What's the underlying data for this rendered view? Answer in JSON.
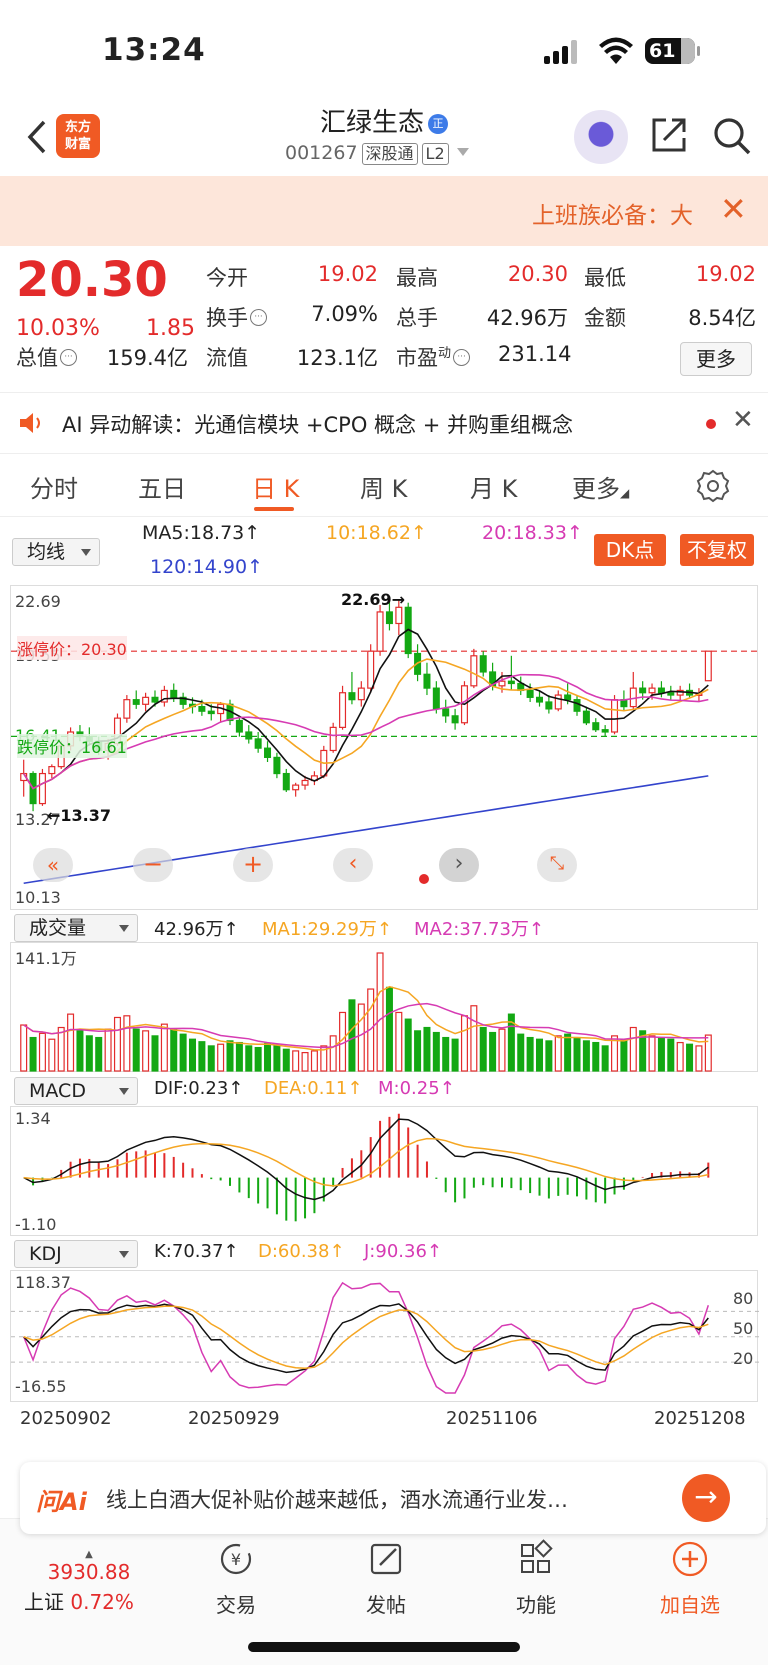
{
  "status": {
    "time": "13:24",
    "battery": "61"
  },
  "header": {
    "logo_line1": "东方",
    "logo_line2": "财富",
    "stock_name": "汇绿生态",
    "badge": "正",
    "code": "001267",
    "tag1": "深股通",
    "tag2": "L2"
  },
  "banner": {
    "text": "上班族必备：大"
  },
  "quote": {
    "price": "20.30",
    "pct": "10.03%",
    "change": "1.85",
    "r1": [
      {
        "label": "今开",
        "value": "19.02",
        "red": true
      },
      {
        "label": "最高",
        "value": "20.30",
        "red": true
      },
      {
        "label": "最低",
        "value": "19.02",
        "red": true
      }
    ],
    "r2": [
      {
        "label": "换手",
        "value": "7.09%"
      },
      {
        "label": "总手",
        "value": "42.96万"
      },
      {
        "label": "金额",
        "value": "8.54亿"
      }
    ],
    "r3": [
      {
        "label": "总值",
        "value": "159.4亿"
      },
      {
        "label": "流值",
        "value": "123.1亿"
      },
      {
        "label": "市盈",
        "sup": "动",
        "value": "231.14"
      }
    ],
    "more": "更多"
  },
  "ai": {
    "text": "AI 异动解读：光通信模块 +CPO 概念 + 并购重组概念"
  },
  "tabs": [
    "分时",
    "五日",
    "日 K",
    "周 K",
    "月 K",
    "更多"
  ],
  "active_tab": 2,
  "ma": {
    "select": "均线",
    "ma5": "MA5:18.73",
    "ma10": "10:18.62",
    "ma20": "20:18.33",
    "ma120": "120:14.90",
    "dk_btn": "DK点",
    "fq_btn": "不复权"
  },
  "kaxis": {
    "top": "22.69",
    "upper": "19.55",
    "mid": "16.41",
    "lower": "13.27",
    "bottom": "10.13",
    "high_label": "22.69",
    "low_label": "13.37",
    "limit_up": "涨停价：20.30",
    "limit_down": "跌停价：16.61"
  },
  "volume": {
    "select": "成交量",
    "val": "42.96万",
    "ma1": "MA1:29.29万",
    "ma2": "MA2:37.73万",
    "max": "141.1万"
  },
  "macd": {
    "select": "MACD",
    "dif": "DIF:0.23",
    "dea": "DEA:0.11",
    "m": "M:0.25",
    "top": "1.34",
    "bottom": "-1.10"
  },
  "kdj": {
    "select": "KDJ",
    "k": "K:70.37",
    "d": "D:60.38",
    "j": "J:90.36",
    "top": "118.37",
    "bottom": "-16.55",
    "l80": "80",
    "l50": "50",
    "l20": "20"
  },
  "dates": [
    "20250902",
    "20250929",
    "20251106",
    "20251208"
  ],
  "ask": {
    "logo": "问Ai",
    "text": "线上白酒大促补贴价越来越低，酒水流通行业发…"
  },
  "bottom": {
    "index_val": "3930.88",
    "index_name": "上证",
    "index_pct": "0.72%",
    "items": [
      "交易",
      "发帖",
      "功能",
      "加自选"
    ]
  },
  "colors": {
    "up": "#e32b2b",
    "down": "#13a813",
    "accent": "#f05a24",
    "ma10": "#f5a623",
    "ma20": "#d63bb3",
    "ma120": "#3344cc"
  },
  "chart_data": {
    "type": "candlestick",
    "ohlc": [
      [
        14.7,
        15.6,
        14.0,
        15.0
      ],
      [
        15.0,
        15.1,
        13.37,
        13.7
      ],
      [
        13.7,
        15.2,
        13.6,
        15.0
      ],
      [
        15.0,
        15.4,
        14.8,
        15.3
      ],
      [
        15.3,
        16.4,
        15.2,
        16.2
      ],
      [
        16.2,
        17.0,
        16.0,
        16.8
      ],
      [
        16.8,
        17.1,
        16.4,
        16.6
      ],
      [
        16.6,
        17.0,
        16.2,
        16.4
      ],
      [
        16.4,
        16.6,
        15.8,
        16.0
      ],
      [
        16.0,
        16.5,
        15.6,
        16.3
      ],
      [
        16.3,
        17.6,
        16.2,
        17.4
      ],
      [
        17.4,
        18.4,
        17.2,
        18.2
      ],
      [
        18.2,
        18.6,
        17.8,
        18.0
      ],
      [
        18.0,
        18.5,
        17.7,
        18.3
      ],
      [
        18.3,
        18.6,
        17.9,
        18.1
      ],
      [
        18.1,
        18.8,
        17.9,
        18.6
      ],
      [
        18.6,
        18.9,
        18.1,
        18.3
      ],
      [
        18.3,
        18.5,
        17.8,
        18.0
      ],
      [
        18.0,
        18.3,
        17.6,
        17.9
      ],
      [
        17.9,
        18.2,
        17.5,
        17.7
      ],
      [
        17.7,
        18.0,
        17.3,
        17.6
      ],
      [
        17.6,
        18.1,
        17.2,
        18.0
      ],
      [
        18.0,
        18.2,
        17.1,
        17.3
      ],
      [
        17.3,
        17.5,
        16.6,
        16.8
      ],
      [
        16.8,
        17.1,
        16.3,
        16.5
      ],
      [
        16.5,
        16.8,
        15.9,
        16.1
      ],
      [
        16.1,
        16.4,
        15.5,
        15.7
      ],
      [
        15.7,
        15.9,
        14.8,
        15.0
      ],
      [
        15.0,
        15.2,
        14.2,
        14.3
      ],
      [
        14.3,
        14.6,
        14.0,
        14.5
      ],
      [
        14.5,
        14.9,
        14.3,
        14.7
      ],
      [
        14.7,
        15.1,
        14.5,
        14.9
      ],
      [
        14.9,
        16.2,
        14.8,
        16.0
      ],
      [
        16.0,
        17.2,
        15.9,
        17.0
      ],
      [
        17.0,
        18.8,
        16.9,
        18.5
      ],
      [
        18.5,
        19.4,
        18.0,
        18.2
      ],
      [
        18.2,
        19.0,
        17.9,
        18.7
      ],
      [
        18.7,
        20.6,
        18.5,
        20.3
      ],
      [
        20.3,
        22.3,
        20.1,
        22.0
      ],
      [
        22.0,
        22.69,
        21.2,
        21.5
      ],
      [
        21.5,
        22.5,
        21.0,
        22.2
      ],
      [
        22.2,
        22.4,
        20.0,
        20.2
      ],
      [
        20.2,
        20.6,
        19.0,
        19.3
      ],
      [
        19.3,
        19.8,
        18.4,
        18.7
      ],
      [
        18.7,
        19.0,
        17.6,
        17.8
      ],
      [
        17.8,
        18.2,
        17.2,
        17.5
      ],
      [
        17.5,
        17.8,
        16.9,
        17.2
      ],
      [
        17.2,
        19.0,
        17.1,
        18.8
      ],
      [
        18.8,
        20.4,
        18.7,
        20.1
      ],
      [
        20.1,
        20.3,
        19.2,
        19.4
      ],
      [
        19.4,
        19.8,
        18.6,
        18.8
      ],
      [
        18.8,
        19.4,
        18.5,
        19.0
      ],
      [
        19.0,
        20.1,
        18.6,
        18.9
      ],
      [
        18.9,
        19.2,
        18.4,
        18.6
      ],
      [
        18.6,
        18.9,
        18.1,
        18.3
      ],
      [
        18.3,
        18.6,
        17.9,
        18.1
      ],
      [
        18.1,
        18.4,
        17.6,
        17.8
      ],
      [
        17.8,
        18.6,
        17.7,
        18.4
      ],
      [
        18.4,
        18.9,
        18.0,
        18.2
      ],
      [
        18.2,
        18.4,
        17.5,
        17.7
      ],
      [
        17.7,
        17.9,
        17.1,
        17.2
      ],
      [
        17.2,
        17.4,
        16.8,
        16.9
      ],
      [
        16.9,
        17.1,
        16.6,
        16.8
      ],
      [
        16.8,
        18.4,
        16.7,
        18.2
      ],
      [
        18.2,
        18.6,
        17.7,
        17.9
      ],
      [
        17.9,
        19.4,
        17.8,
        18.7
      ],
      [
        18.7,
        19.0,
        18.2,
        18.5
      ],
      [
        18.5,
        18.9,
        18.2,
        18.7
      ],
      [
        18.7,
        19.0,
        18.3,
        18.5
      ],
      [
        18.5,
        18.8,
        18.2,
        18.4
      ],
      [
        18.4,
        18.8,
        18.1,
        18.6
      ],
      [
        18.6,
        18.9,
        18.3,
        18.4
      ],
      [
        18.4,
        18.7,
        18.1,
        18.45
      ],
      [
        19.02,
        20.3,
        19.02,
        20.3
      ]
    ],
    "ylim": [
      10.13,
      22.69
    ]
  }
}
